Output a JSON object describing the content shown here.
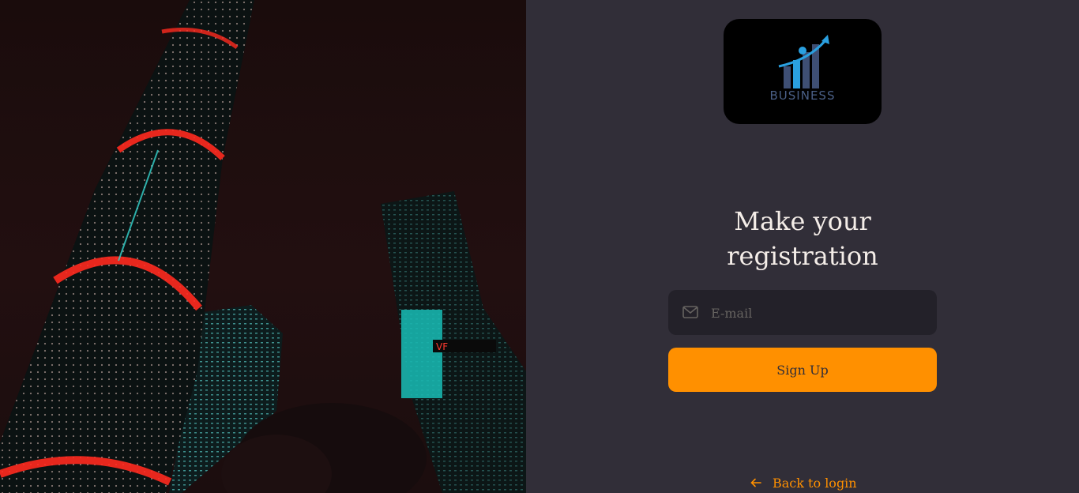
{
  "logo": {
    "text": "BUSINESS",
    "icon": "business-growth-chart-icon"
  },
  "form": {
    "title_line1": "Make your",
    "title_line2": "registration",
    "email_placeholder": "E-mail",
    "email_value": "",
    "email_icon": "mail-icon",
    "signup_label": "Sign Up"
  },
  "footer": {
    "back_label": "Back to login",
    "back_icon": "arrow-left-icon"
  },
  "colors": {
    "accent": "#ff9000",
    "background": "#312e38",
    "input_bg": "#232129",
    "text": "#f4ede8",
    "placeholder": "#666360"
  }
}
